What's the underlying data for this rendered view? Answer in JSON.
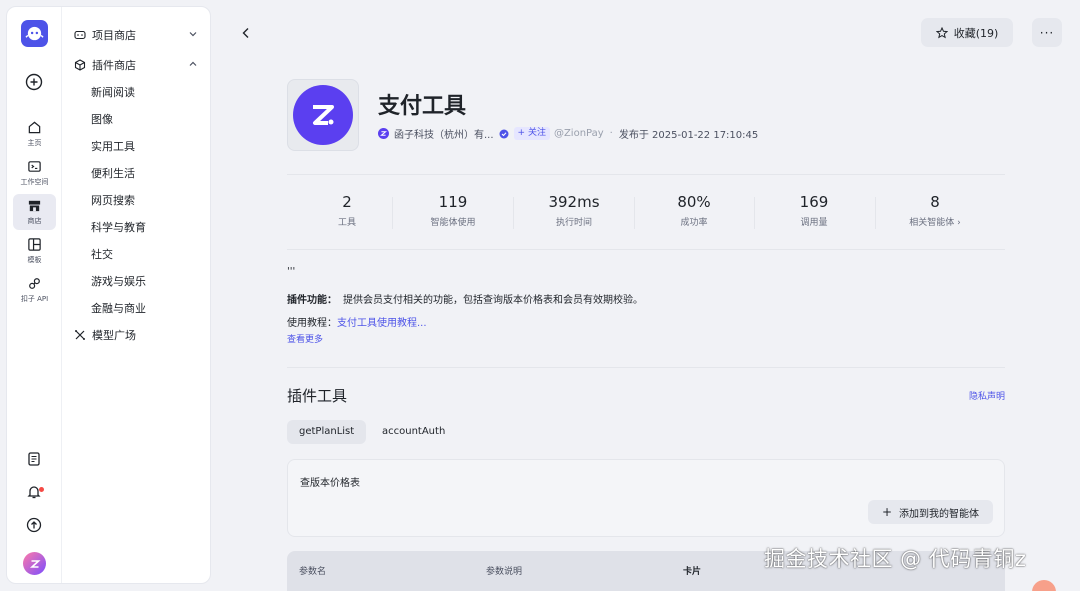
{
  "rail": {
    "items": [
      {
        "label": "主页",
        "icon": "home-icon"
      },
      {
        "label": "工作空间",
        "icon": "terminal-icon"
      },
      {
        "label": "商店",
        "icon": "store-icon"
      },
      {
        "label": "模板",
        "icon": "template-icon"
      },
      {
        "label": "扣子 API",
        "icon": "link-icon"
      }
    ]
  },
  "subnav": {
    "project_store": "项目商店",
    "plugin_store": "插件商店",
    "categories": [
      "新闻阅读",
      "图像",
      "实用工具",
      "便利生活",
      "网页搜索",
      "科学与教育",
      "社交",
      "游戏与娱乐",
      "金融与商业"
    ],
    "model_square": "模型广场"
  },
  "header": {
    "fav_label": "收藏(19)",
    "more_label": "···"
  },
  "plugin": {
    "title": "支付工具",
    "publisher": "函子科技（杭州）有...",
    "follow": "+ 关注",
    "handle": "@ZionPay",
    "dot": "·",
    "published": "发布于 2025-01-22 17:10:45"
  },
  "stats": [
    {
      "value": "2",
      "label": "工具"
    },
    {
      "value": "119",
      "label": "智能体使用"
    },
    {
      "value": "392ms",
      "label": "执行时间"
    },
    {
      "value": "80%",
      "label": "成功率"
    },
    {
      "value": "169",
      "label": "调用量"
    },
    {
      "value": "8",
      "label": "相关智能体 ›"
    }
  ],
  "description": {
    "quote": "'''",
    "feature_label": "插件功能：",
    "feature_text": "提供会员支付相关的功能，包括查询版本价格表和会员有效期校验。",
    "tutorial_label": "使用教程：",
    "tutorial_link": "支付工具使用教程...",
    "see_more": "查看更多"
  },
  "tools": {
    "section_title": "插件工具",
    "privacy": "隐私声明",
    "tabs": [
      "getPlanList",
      "accountAuth"
    ],
    "card_name": "查版本价格表",
    "add_button": "添加到我的智能体",
    "add_plus": "+"
  },
  "param_table": {
    "headers": [
      "参数名",
      "参数说明",
      "卡片"
    ]
  },
  "watermark": "掘金技术社区 @ 代码青铜z",
  "colors": {
    "accent": "#4d53e8",
    "brand_purple": "#5b3ff0",
    "bg": "#f1f2f6"
  }
}
